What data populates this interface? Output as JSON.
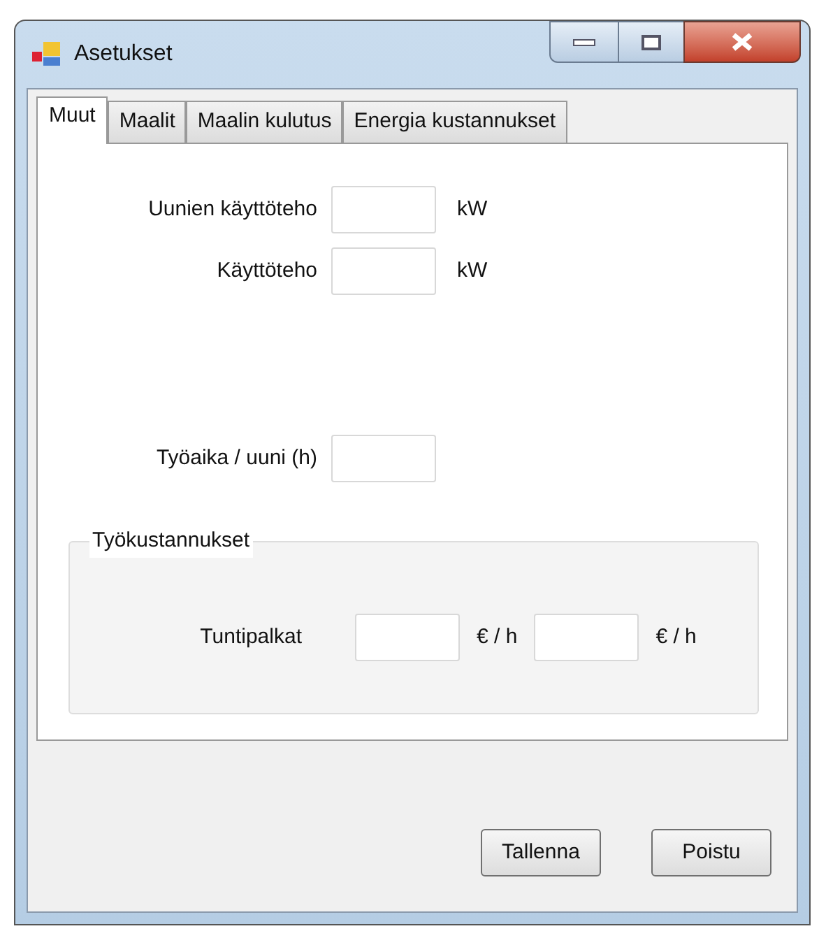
{
  "window": {
    "title": "Asetukset"
  },
  "tabs": [
    {
      "label": "Muut",
      "selected": true
    },
    {
      "label": "Maalit",
      "selected": false
    },
    {
      "label": "Maalin kulutus",
      "selected": false
    },
    {
      "label": "Energia kustannukset",
      "selected": false
    }
  ],
  "fields": [
    {
      "label": "Uunien käyttöteho",
      "unit": "kW"
    },
    {
      "label": "Käyttöteho",
      "unit": "kW"
    }
  ],
  "work_time": {
    "label": "Työaika / uuni (h)"
  },
  "group": {
    "title": "Työkustannukset",
    "label": "Tuntipalkat",
    "units": [
      "€ / h",
      "€ / h"
    ]
  },
  "buttons": [
    "Tallenna",
    "Poistu"
  ]
}
